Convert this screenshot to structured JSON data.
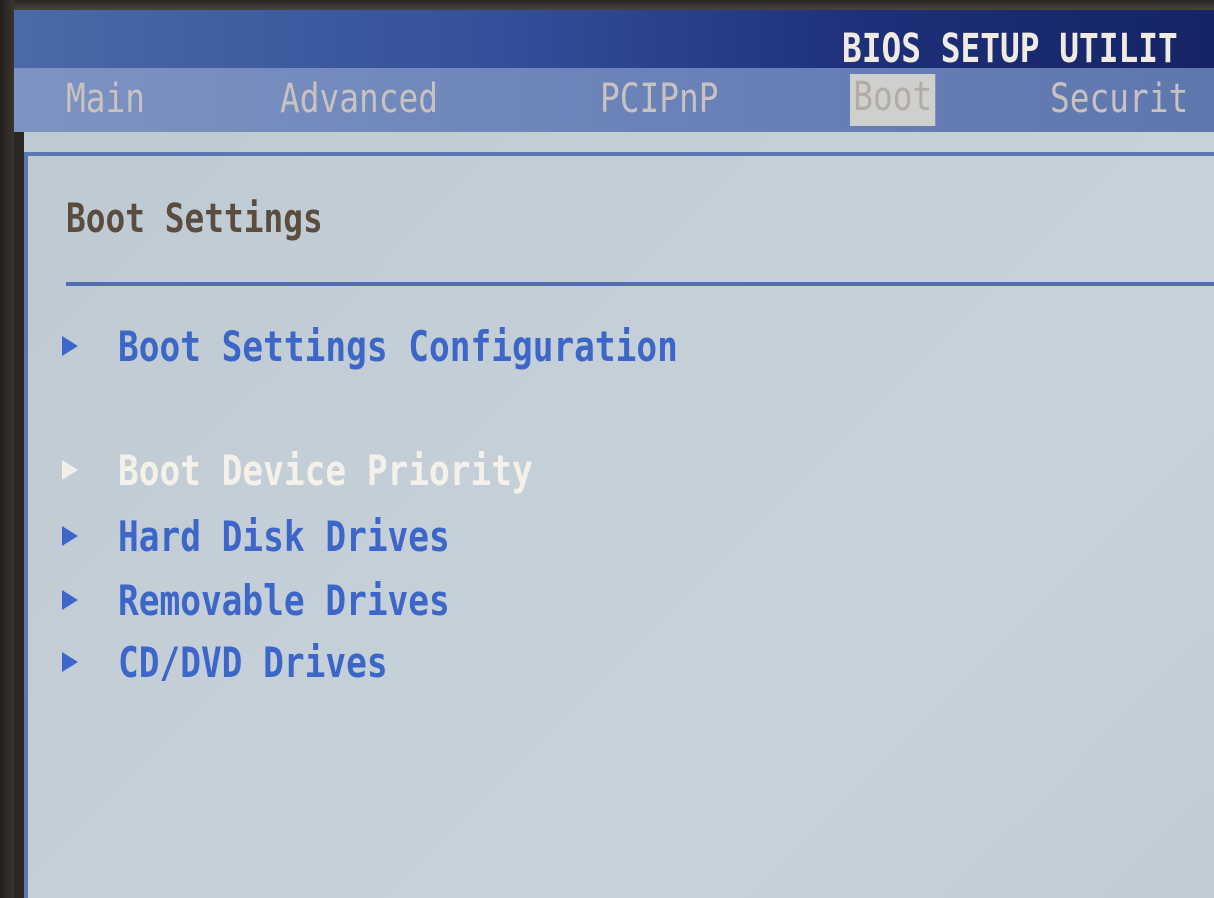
{
  "title": "BIOS SETUP UTILIT",
  "tabs": [
    {
      "label": "Main"
    },
    {
      "label": "Advanced"
    },
    {
      "label": "PCIPnP"
    },
    {
      "label": "Boot"
    },
    {
      "label": "Securit"
    }
  ],
  "active_tab": "Boot",
  "section_title": "Boot Settings",
  "menu": [
    {
      "label": "Boot Settings Configuration",
      "selected": false
    },
    {
      "label": "Boot Device Priority",
      "selected": true
    },
    {
      "label": "Hard Disk Drives",
      "selected": false
    },
    {
      "label": "Removable Drives",
      "selected": false
    },
    {
      "label": "CD/DVD Drives",
      "selected": false
    }
  ],
  "colors": {
    "title_bar": "#1d2f78",
    "menu_bar": "#6b83b8",
    "content_bg": "#c4cfd8",
    "item_text": "#3c67c8",
    "selected_text": "#f4f1eb",
    "section_title": "#5a4d40"
  },
  "icons": {
    "submenu_arrow": "triangle-right-icon"
  }
}
